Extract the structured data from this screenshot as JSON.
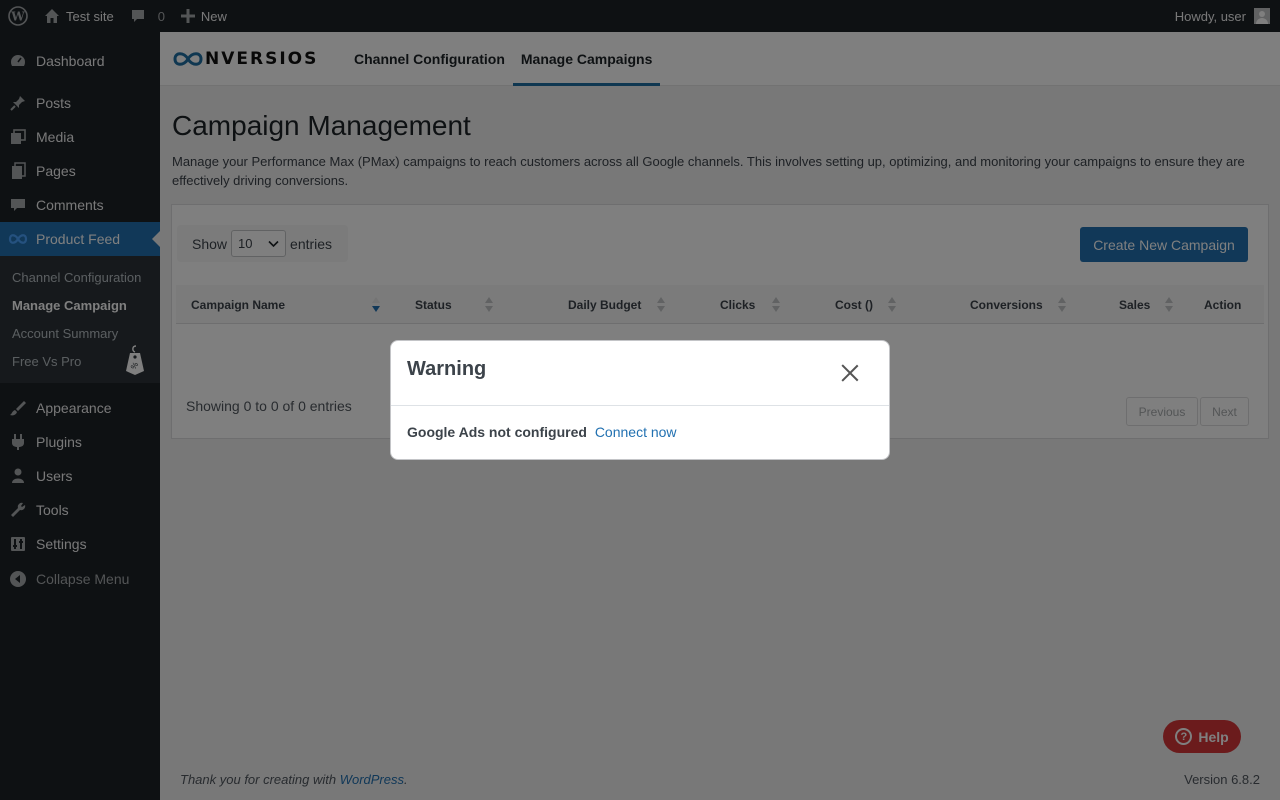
{
  "admin_bar": {
    "site_name": "Test site",
    "comments_count": "0",
    "new_label": "New",
    "howdy": "Howdy, user"
  },
  "sidebar": {
    "items": [
      {
        "label": "Dashboard",
        "icon": "dashboard-icon"
      },
      {
        "label": "Posts",
        "icon": "pin-icon"
      },
      {
        "label": "Media",
        "icon": "media-icon"
      },
      {
        "label": "Pages",
        "icon": "pages-icon"
      },
      {
        "label": "Comments",
        "icon": "comment-icon"
      },
      {
        "label": "Product Feed",
        "icon": "conversios-icon"
      }
    ],
    "submenu": [
      {
        "label": "Channel Configuration"
      },
      {
        "label": "Manage Campaign"
      },
      {
        "label": "Account Summary"
      },
      {
        "label": "Free Vs Pro"
      }
    ],
    "items2": [
      {
        "label": "Appearance",
        "icon": "brush-icon"
      },
      {
        "label": "Plugins",
        "icon": "plugin-icon"
      },
      {
        "label": "Users",
        "icon": "users-icon"
      },
      {
        "label": "Tools",
        "icon": "wrench-icon"
      },
      {
        "label": "Settings",
        "icon": "settings-icon"
      }
    ],
    "collapse": "Collapse Menu"
  },
  "plugin_header": {
    "logo_text": "NVERSIOS",
    "tabs": [
      {
        "label": "Channel Configuration"
      },
      {
        "label": "Manage Campaigns"
      }
    ]
  },
  "page": {
    "title": "Campaign Management",
    "description": "Manage your Performance Max (PMax) campaigns to reach customers across all Google channels. This involves setting up, optimizing, and monitoring your campaigns to ensure they are effectively driving conversions."
  },
  "table_controls": {
    "show": "Show",
    "entries_value": "10",
    "entries": "entries",
    "create_button": "Create New Campaign"
  },
  "table": {
    "columns": [
      "Campaign Name",
      "Status",
      "Daily Budget",
      "Clicks",
      "Cost ()",
      "Conversions",
      "Sales",
      "Action"
    ],
    "info": "Showing 0 to 0 of 0 entries",
    "previous": "Previous",
    "next": "Next"
  },
  "footer": {
    "thanks": "Thank you for creating with",
    "wordpress": "WordPress",
    "period": ".",
    "version": "Version 6.8.2"
  },
  "help": {
    "label": "Help"
  },
  "modal": {
    "title": "Warning",
    "message": "Google Ads not configured",
    "link": "Connect now"
  },
  "colors": {
    "admin_dark": "#1d2327",
    "accent": "#2271b1",
    "help_red": "#d63638"
  }
}
